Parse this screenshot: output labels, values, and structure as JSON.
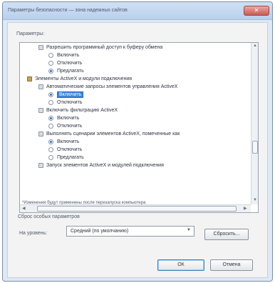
{
  "window": {
    "title": "Параметры безопасности — зона надежных сайтов"
  },
  "settings": {
    "label": "Параметры:",
    "items": [
      {
        "kind": "group",
        "label": "Разрешить программный доступ к буферу обмена"
      },
      {
        "kind": "radio",
        "label": "Включить",
        "checked": false
      },
      {
        "kind": "radio",
        "label": "Отключить",
        "checked": false
      },
      {
        "kind": "radio",
        "label": "Предлагать",
        "checked": true
      },
      {
        "kind": "category",
        "label": "Элементы ActiveX и модули подключения"
      },
      {
        "kind": "group",
        "label": "Автоматические запросы элементов управления ActiveX"
      },
      {
        "kind": "radio",
        "label": "Включить",
        "checked": true,
        "selected": true
      },
      {
        "kind": "radio",
        "label": "Отключить",
        "checked": false
      },
      {
        "kind": "group",
        "label": "Включить фильтрацию ActiveX"
      },
      {
        "kind": "radio",
        "label": "Включить",
        "checked": true
      },
      {
        "kind": "radio",
        "label": "Отключить",
        "checked": false
      },
      {
        "kind": "group",
        "label": "Выполнять сценарии элементов ActiveX, помеченные как"
      },
      {
        "kind": "radio",
        "label": "Включить",
        "checked": true
      },
      {
        "kind": "radio",
        "label": "Отключить",
        "checked": false
      },
      {
        "kind": "radio",
        "label": "Предлагать",
        "checked": false
      },
      {
        "kind": "group",
        "label": "Запуск элементов ActiveX и модулей подключения"
      }
    ]
  },
  "notice": "*Изменения будут применены после перезапуска компьютера",
  "reset": {
    "section_label": "Сброс особых параметров",
    "level_label": "На уровень:",
    "level_value": "Средний (по умолчанию)",
    "reset_button": "Сбросить..."
  },
  "buttons": {
    "ok": "ОК",
    "cancel": "Отмена"
  },
  "colors": {
    "selection": "#3d86d8",
    "title_bar": "#c4d8f0",
    "close": "#c85b52"
  }
}
